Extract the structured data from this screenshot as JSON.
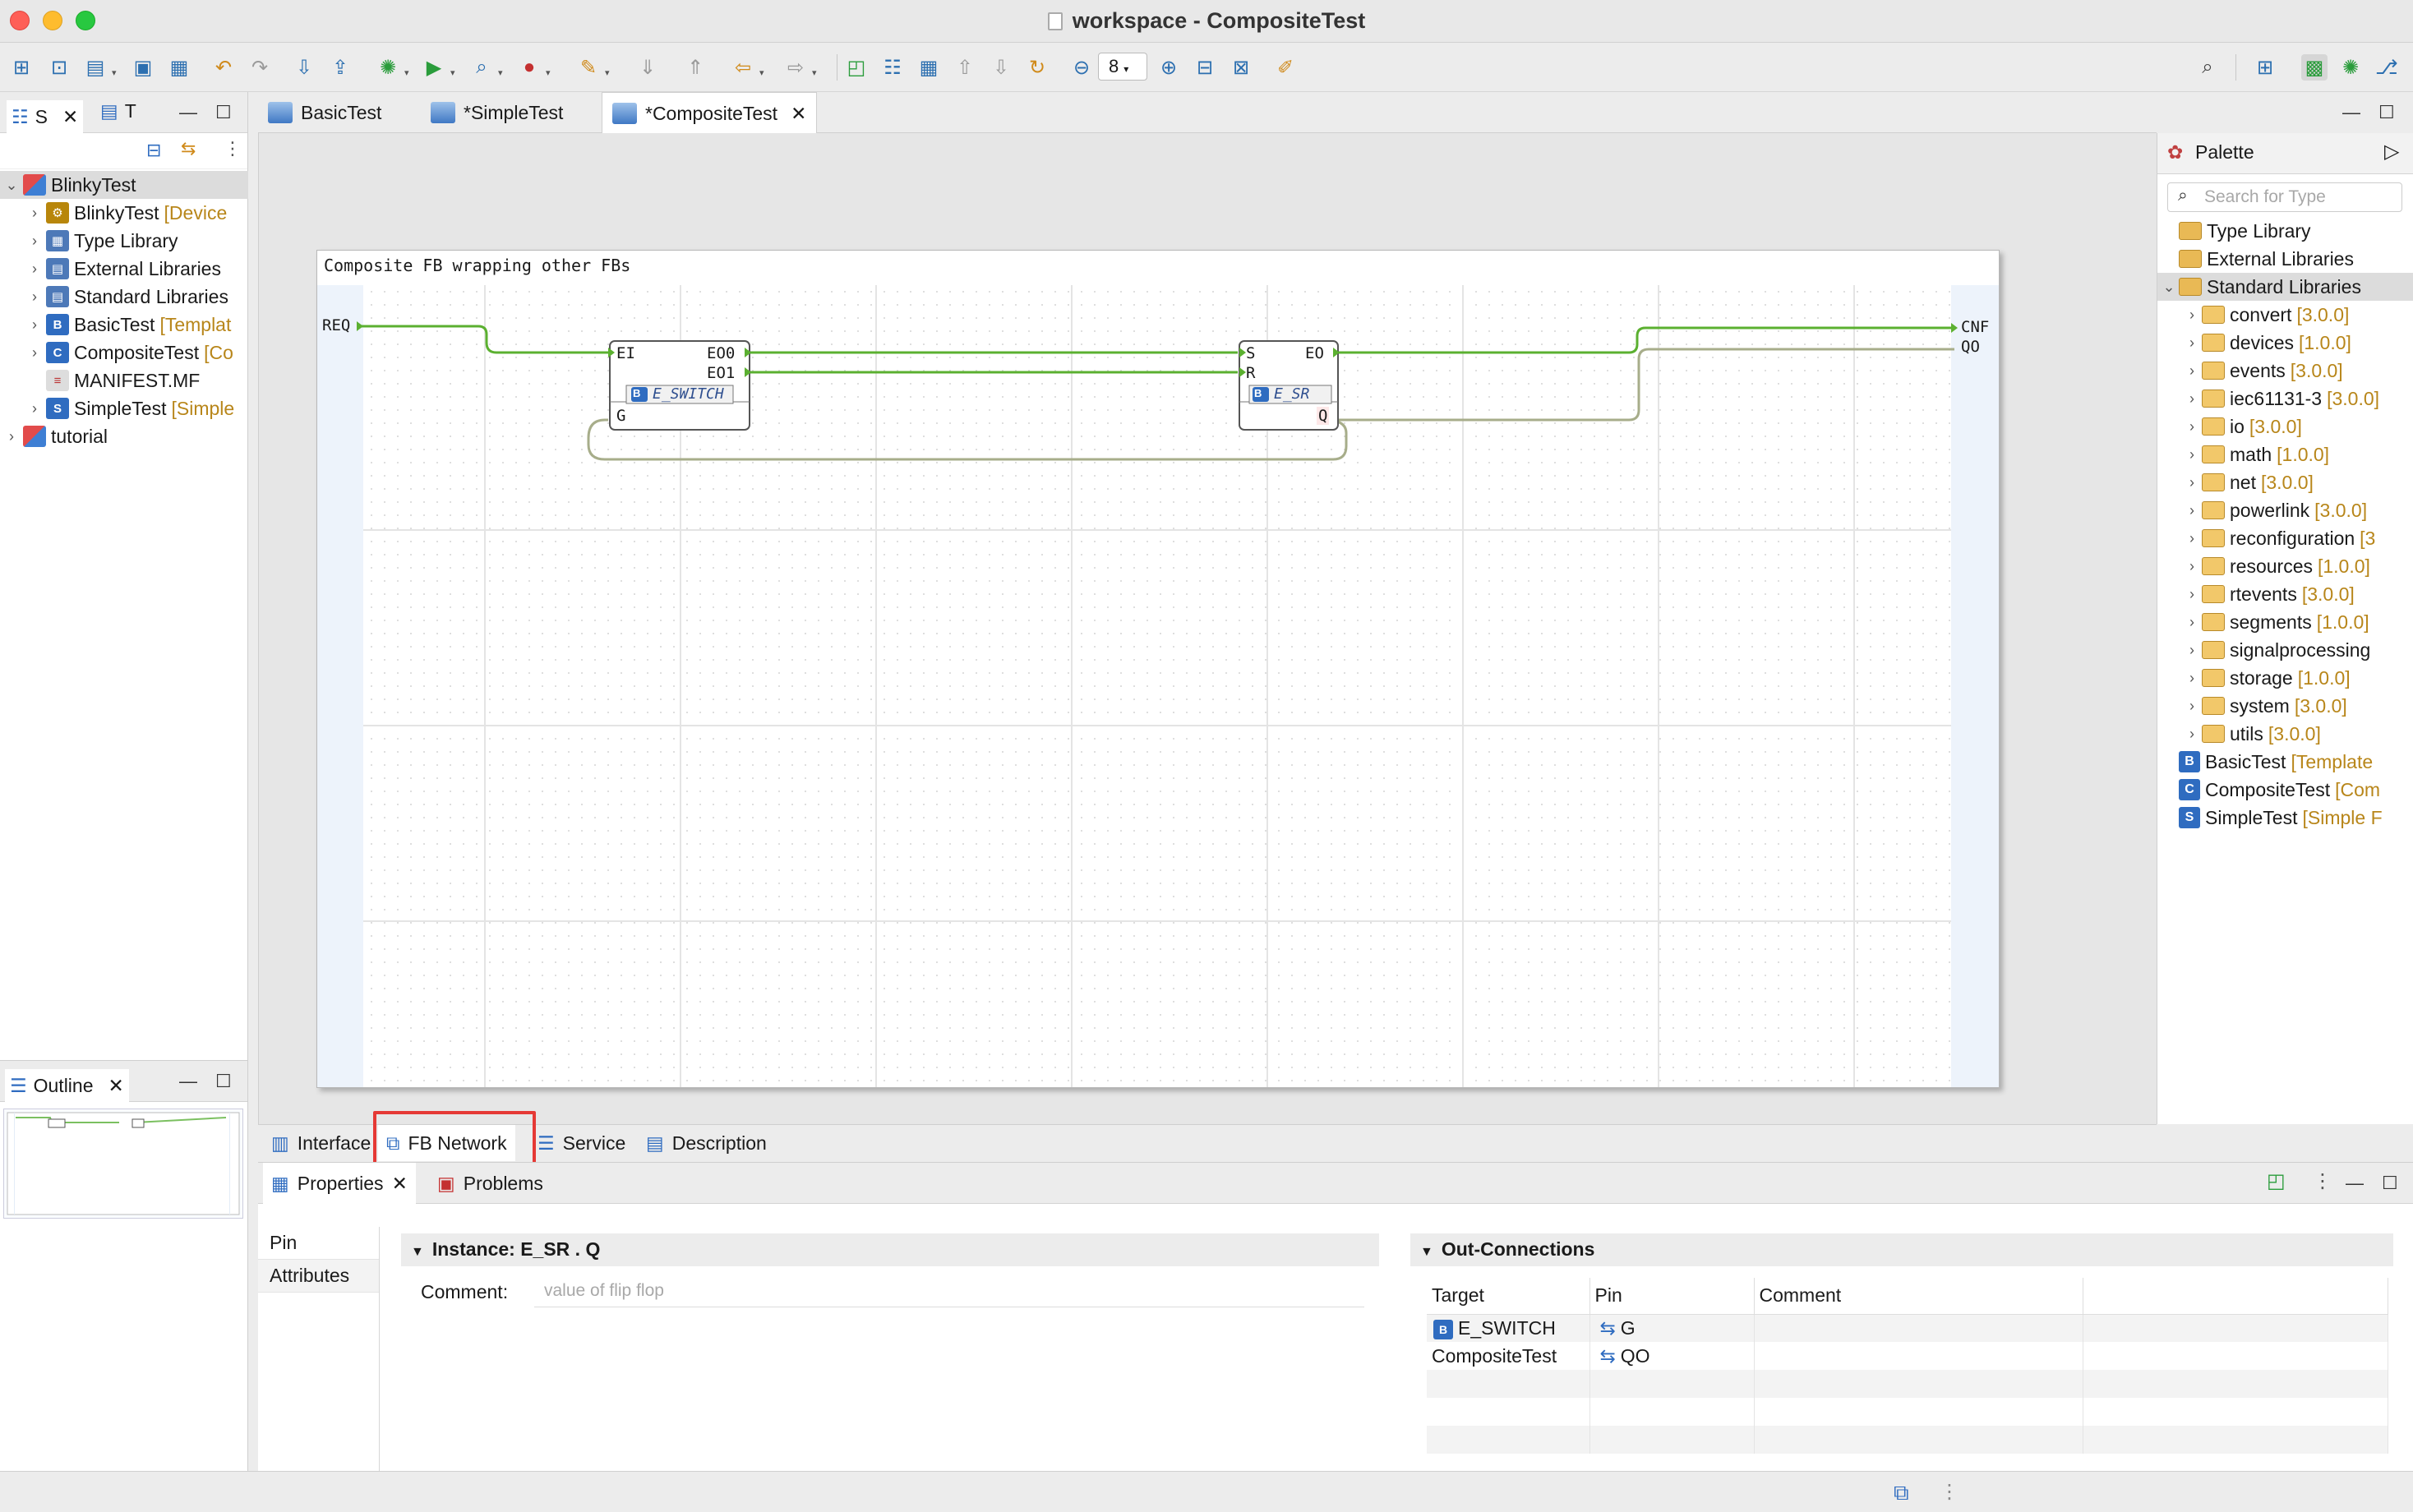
{
  "window": {
    "title": "workspace - CompositeTest"
  },
  "left_panel": {
    "tabs": [
      {
        "label": "S"
      },
      {
        "label": "T"
      }
    ],
    "tree": [
      {
        "label": "BlinkyTest",
        "deco": "",
        "icon": "project-icon",
        "level": 0,
        "expanded": true,
        "selected": true
      },
      {
        "label": "BlinkyTest",
        "deco": "[Device",
        "icon": "device-icon",
        "level": 1
      },
      {
        "label": "Type Library",
        "deco": "",
        "icon": "type-library-icon",
        "level": 1
      },
      {
        "label": "External Libraries",
        "deco": "",
        "icon": "library-icon",
        "level": 1
      },
      {
        "label": "Standard Libraries",
        "deco": "",
        "icon": "library-icon",
        "level": 1
      },
      {
        "label": "BasicTest",
        "deco": "[Templat",
        "icon": "basic-fb-icon",
        "level": 1
      },
      {
        "label": "CompositeTest",
        "deco": "[Co",
        "icon": "composite-fb-icon",
        "level": 1
      },
      {
        "label": "MANIFEST.MF",
        "deco": "",
        "icon": "manifest-icon",
        "level": 1,
        "leaf": true
      },
      {
        "label": "SimpleTest",
        "deco": "[Simple",
        "icon": "simple-fb-icon",
        "level": 1
      },
      {
        "label": "tutorial",
        "deco": "",
        "icon": "project-icon",
        "level": 0
      }
    ]
  },
  "outline": {
    "label": "Outline"
  },
  "editor": {
    "tabs": [
      {
        "label": "BasicTest",
        "active": false
      },
      {
        "label": "*SimpleTest",
        "active": false
      },
      {
        "label": "*CompositeTest",
        "active": true
      }
    ],
    "bottom_tabs": [
      {
        "label": "Interface"
      },
      {
        "label": "FB Network",
        "active": true
      },
      {
        "label": "Service"
      },
      {
        "label": "Description"
      }
    ],
    "fb_network": {
      "comment": "Composite FB wrapping other FBs",
      "inputs": [
        "REQ"
      ],
      "outputs": [
        "CNF",
        "QO"
      ],
      "blocks": [
        {
          "instance": "E_SWITCH",
          "type": "E_SWITCH",
          "type_badge": "B",
          "event_inputs": [
            "EI"
          ],
          "event_outputs": [
            "EO0",
            "EO1"
          ],
          "data_inputs": [
            "G"
          ],
          "data_outputs": []
        },
        {
          "instance": "E_SR",
          "type": "E_SR",
          "type_badge": "B",
          "event_inputs": [
            "S",
            "R"
          ],
          "event_outputs": [
            "EO"
          ],
          "data_inputs": [],
          "data_outputs": [
            "Q"
          ]
        }
      ]
    }
  },
  "palette": {
    "title": "Palette",
    "search_placeholder": "Search for Type",
    "items": [
      {
        "label": "Type Library",
        "deco": "",
        "level": 0,
        "kind": "folder"
      },
      {
        "label": "External Libraries",
        "deco": "",
        "level": 0,
        "kind": "folder"
      },
      {
        "label": "Standard Libraries",
        "deco": "",
        "level": 0,
        "kind": "folder",
        "expanded": true,
        "selected": true
      },
      {
        "label": "convert",
        "deco": "[3.0.0]",
        "level": 1,
        "kind": "lib"
      },
      {
        "label": "devices",
        "deco": "[1.0.0]",
        "level": 1,
        "kind": "lib"
      },
      {
        "label": "events",
        "deco": "[3.0.0]",
        "level": 1,
        "kind": "lib"
      },
      {
        "label": "iec61131-3",
        "deco": "[3.0.0]",
        "level": 1,
        "kind": "lib"
      },
      {
        "label": "io",
        "deco": "[3.0.0]",
        "level": 1,
        "kind": "lib"
      },
      {
        "label": "math",
        "deco": "[1.0.0]",
        "level": 1,
        "kind": "lib"
      },
      {
        "label": "net",
        "deco": "[3.0.0]",
        "level": 1,
        "kind": "lib"
      },
      {
        "label": "powerlink",
        "deco": "[3.0.0]",
        "level": 1,
        "kind": "lib"
      },
      {
        "label": "reconfiguration",
        "deco": "[3",
        "level": 1,
        "kind": "lib"
      },
      {
        "label": "resources",
        "deco": "[1.0.0]",
        "level": 1,
        "kind": "lib"
      },
      {
        "label": "rtevents",
        "deco": "[3.0.0]",
        "level": 1,
        "kind": "lib"
      },
      {
        "label": "segments",
        "deco": "[1.0.0]",
        "level": 1,
        "kind": "lib"
      },
      {
        "label": "signalprocessing",
        "deco": "",
        "level": 1,
        "kind": "lib"
      },
      {
        "label": "storage",
        "deco": "[1.0.0]",
        "level": 1,
        "kind": "lib"
      },
      {
        "label": "system",
        "deco": "[3.0.0]",
        "level": 1,
        "kind": "lib"
      },
      {
        "label": "utils",
        "deco": "[3.0.0]",
        "level": 1,
        "kind": "lib"
      },
      {
        "label": "BasicTest",
        "deco": "[Template",
        "level": 0,
        "kind": "B"
      },
      {
        "label": "CompositeTest",
        "deco": "[Com",
        "level": 0,
        "kind": "C"
      },
      {
        "label": "SimpleTest",
        "deco": "[Simple F",
        "level": 0,
        "kind": "S"
      }
    ]
  },
  "toolbar": {
    "zoom_value": "8"
  },
  "properties": {
    "tabs": [
      {
        "label": "Properties",
        "active": true
      },
      {
        "label": "Problems"
      }
    ],
    "side_tabs": [
      {
        "label": "Pin",
        "active": true
      },
      {
        "label": "Attributes"
      }
    ],
    "instance_header": "Instance: E_SR . Q",
    "comment_label": "Comment:",
    "comment_placeholder": "value of flip flop",
    "out_connections_header": "Out-Connections",
    "table": {
      "columns": [
        "Target",
        "Pin",
        "Comment"
      ],
      "rows": [
        {
          "target": "E_SWITCH",
          "target_badge": "B",
          "pin": "G",
          "comment": ""
        },
        {
          "target": "CompositeTest",
          "target_badge": "",
          "pin": "QO",
          "comment": ""
        }
      ]
    }
  },
  "colors": {
    "connection": "#4caf28",
    "data_connection": "#9aa77a",
    "highlight": "#e53935"
  }
}
